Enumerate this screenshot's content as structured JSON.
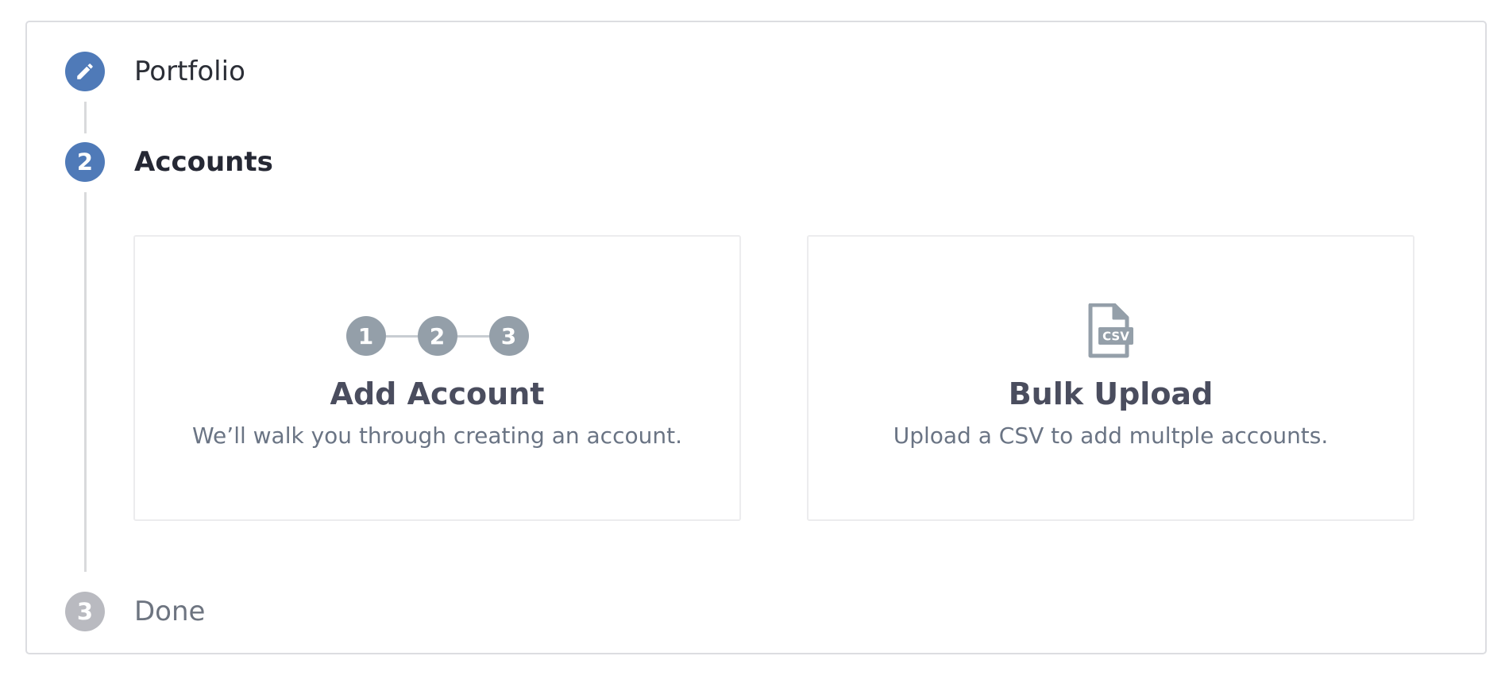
{
  "wizard": {
    "steps": [
      {
        "number": "",
        "label": "Portfolio",
        "state": "completed",
        "icon": "pencil-icon"
      },
      {
        "number": "2",
        "label": "Accounts",
        "state": "active"
      },
      {
        "number": "3",
        "label": "Done",
        "state": "pending"
      }
    ]
  },
  "options": {
    "add_account": {
      "steps": [
        "1",
        "2",
        "3"
      ],
      "title": "Add Account",
      "description": "We’ll walk you through creating an account."
    },
    "bulk_upload": {
      "icon": "csv-file-icon",
      "icon_text": "CSV",
      "title": "Bulk Upload",
      "description": "Upload a CSV to add multple accounts."
    }
  },
  "colors": {
    "accent": "#4f7ab8",
    "pending": "#b9bac0",
    "muted_icon": "#949fa9"
  }
}
